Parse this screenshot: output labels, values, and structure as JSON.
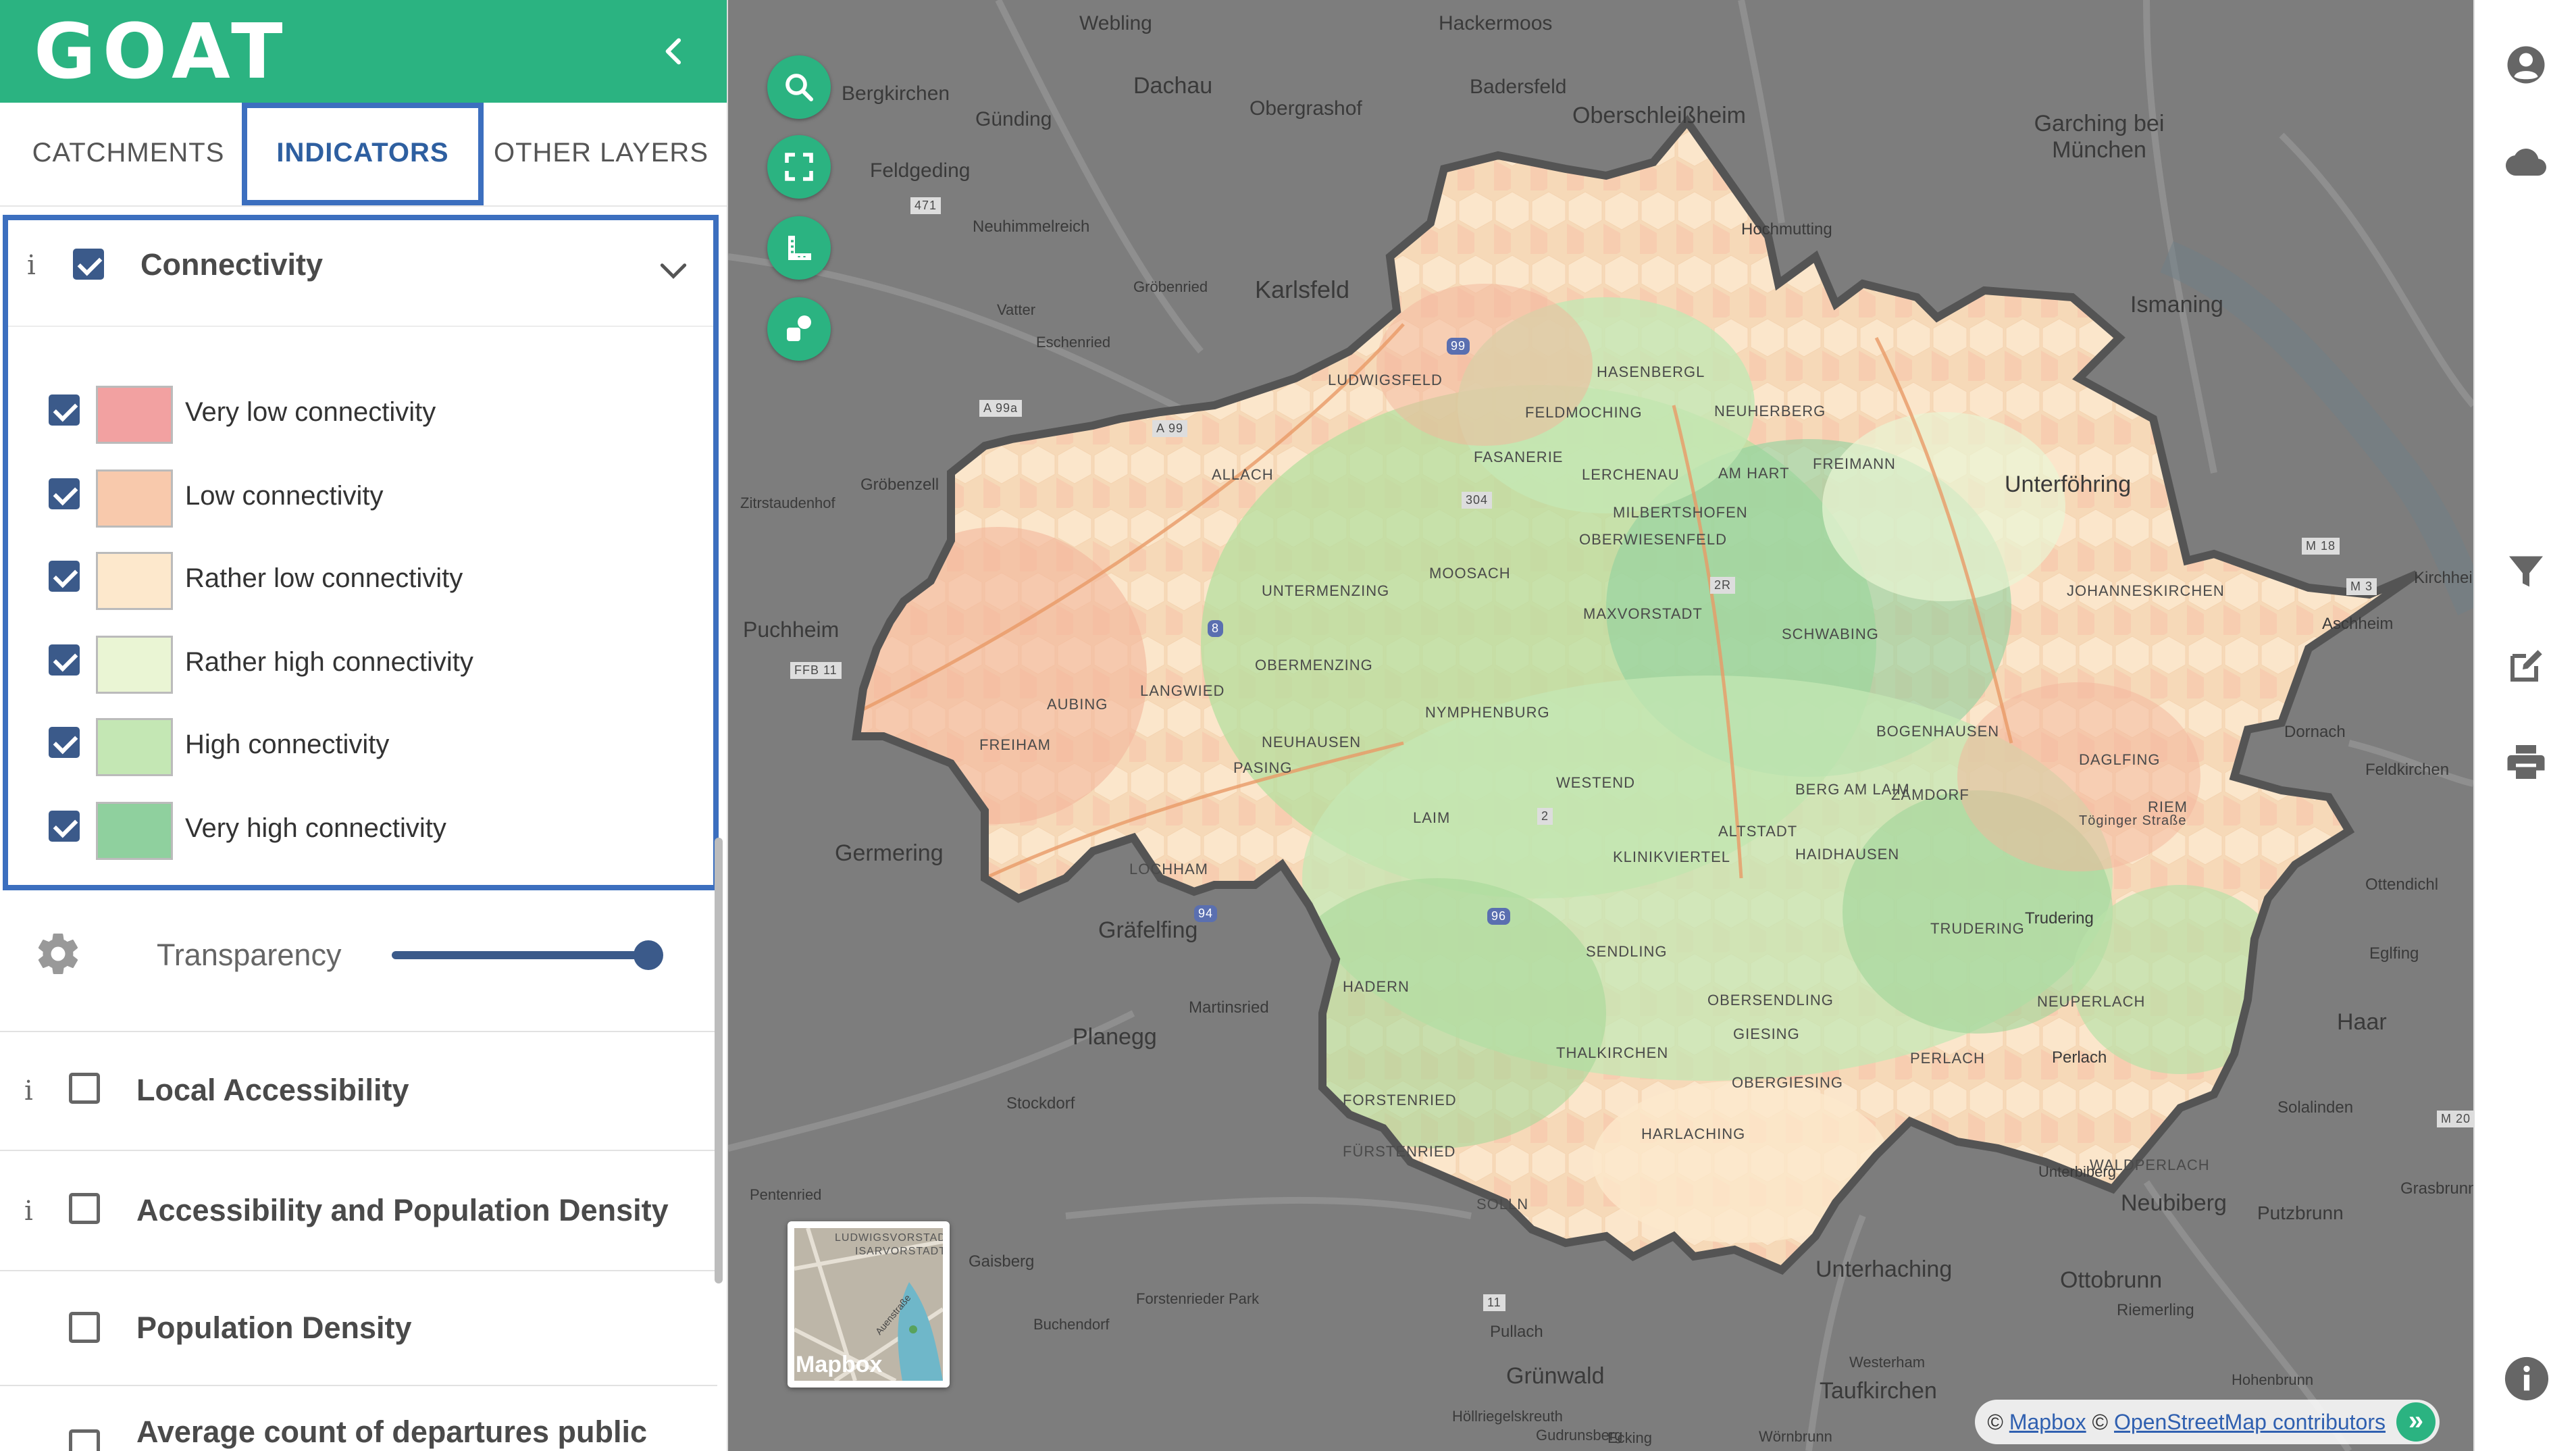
{
  "app": {
    "logo": "GOAT"
  },
  "tabs": [
    {
      "label": "CATCHMENTS"
    },
    {
      "label": "INDICATORS"
    },
    {
      "label": "OTHER LAYERS"
    }
  ],
  "connectivity": {
    "info": "i",
    "title": "Connectivity",
    "checked": true,
    "legend": [
      {
        "label": "Very low connectivity",
        "color": "#f2a1a1"
      },
      {
        "label": "Low connectivity",
        "color": "#f8c9ac"
      },
      {
        "label": "Rather low connectivity",
        "color": "#fde8cc"
      },
      {
        "label": "Rather high connectivity",
        "color": "#eaf5d4"
      },
      {
        "label": "High connectivity",
        "color": "#c4e7b4"
      },
      {
        "label": "Very high connectivity",
        "color": "#8fd09e"
      }
    ]
  },
  "transparency": {
    "label": "Transparency",
    "value": 1.0
  },
  "layers": [
    {
      "info": "i",
      "title": "Local Accessibility",
      "checked": false
    },
    {
      "info": "i",
      "title": "Accessibility and Population Density",
      "checked": false
    },
    {
      "info": "",
      "title": "Population Density",
      "checked": false
    },
    {
      "info": "",
      "title": "Average count of departures public",
      "checked": false
    }
  ],
  "map": {
    "places": [
      "Webling",
      "Hackermoos",
      "Dachau",
      "Badersfeld",
      "Oberschleißheim",
      "Bergkirchen",
      "Günding",
      "Obergrashof",
      "Garching bei München",
      "Feldgeding",
      "Neuhimmelreich",
      "Karlsfeld",
      "Hochmutting",
      "Ismaning",
      "Gröbenried",
      "Eschenried",
      "Vatter",
      "Puchheim",
      "Gröbenzell",
      "Zitrstaudenhof",
      "Unterföhring",
      "Germering",
      "Gräfelfing",
      "Planegg",
      "Martinsried",
      "Stockdorf",
      "Gaisberg",
      "Neubiberg",
      "Unterhaching",
      "Ottobrunn",
      "Taufkirchen",
      "Grünwald",
      "Pullach",
      "Haar",
      "Aschheim",
      "Dornach",
      "Feldkirchen",
      "Putzbrunn",
      "Riemerling",
      "Höllriegelskreuth",
      "Buchendorf",
      "Forstenrieder Park",
      "Solalinden",
      "Ottendichl",
      "Eglfing",
      "Grasbrunn",
      "Westerham",
      "Hohenbrunn",
      "Ecking",
      "Wörnbrunn",
      "Gudrunsberg",
      "Unterbiberg",
      "Perlach",
      "Trudering",
      "Kirchheim",
      "Pentenried"
    ],
    "districts": [
      "HASENBERGL",
      "LUDWIGSFELD",
      "FASANERIE",
      "LERCHENAU",
      "FELDMOCHING",
      "ALLACH",
      "UNTERMENZING",
      "MOOSACH",
      "OBERWIESENFELD",
      "SCHWABING",
      "FREIMANN",
      "NEUHERBERG",
      "NYMPHENBURG",
      "NEUHAUSEN",
      "BOGENHAUSEN",
      "DAGLFING",
      "RIEM",
      "BERG AM LAIM",
      "TRUDERING",
      "PERLACH",
      "SENDLING",
      "HADERN",
      "OBERSENDLING",
      "THALKIRCHEN",
      "HARLACHING",
      "GIESING",
      "OBERGIESING",
      "AUBING",
      "LANGWIED",
      "PASING",
      "LAIM",
      "FORSTENRIED",
      "FÜRSTENRIED",
      "SOLLN",
      "WESTEND",
      "MAXVORSTADT",
      "ALTSTADT",
      "JOHANNESKIRCHEN",
      "ZAMDORF",
      "AM HART",
      "MILBERTSHOFEN",
      "HAIDHAUSEN",
      "KLINIKVIERTEL",
      "NEUPERLACH",
      "WALDPERLACH",
      "LOCHHAM",
      "FREIHAM",
      "OBERMENZING"
    ],
    "roads": [
      "A 99a",
      "A 99",
      "471",
      "304",
      "2R",
      "M 3",
      "FFB 11",
      "11",
      "M 20",
      "M 18",
      "Töginger Straße",
      "99",
      "96",
      "94",
      "8",
      "2"
    ],
    "basemap_label": "Mapbox",
    "basemap_streets": [
      "LUDWIGSVORSTADT",
      "ISARVORSTADT",
      "Auenstraße"
    ],
    "attribution": {
      "prefix": "©",
      "mapbox": "Mapbox",
      "sep": "©",
      "osm": "OpenStreetMap contributors",
      "more": "»"
    }
  }
}
